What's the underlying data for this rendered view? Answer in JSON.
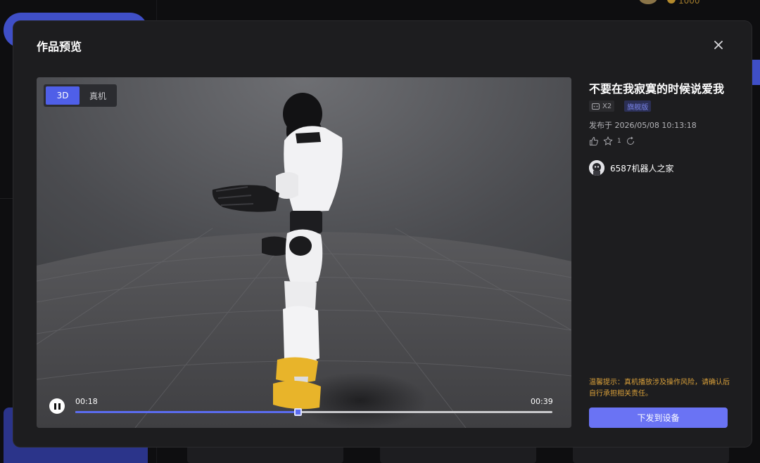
{
  "background": {
    "coin_text": "1000"
  },
  "modal": {
    "title": "作品预览"
  },
  "viewer": {
    "modes": [
      {
        "label": "3D",
        "active": true
      },
      {
        "label": "真机",
        "active": false
      }
    ],
    "player": {
      "current_time": "00:18",
      "total_time": "00:39",
      "progress_fraction": 0.466,
      "state": "playing"
    }
  },
  "work": {
    "title": "不要在我寂寞的时候说爱我",
    "model_tag": "X2",
    "edition_tag": "旗舰版",
    "published": "发布于 2026/05/08 10:13:18",
    "favorite_count": "1",
    "author": "6587机器人之家"
  },
  "warning": "温馨提示：真机播放涉及操作风险，请确认后自行承担相关责任。",
  "send_button": "下发到设备",
  "colors": {
    "accent": "#5b6cf0",
    "button": "#6a73f4",
    "warning": "#d9a03a",
    "modal_bg": "#1d1d1f"
  }
}
